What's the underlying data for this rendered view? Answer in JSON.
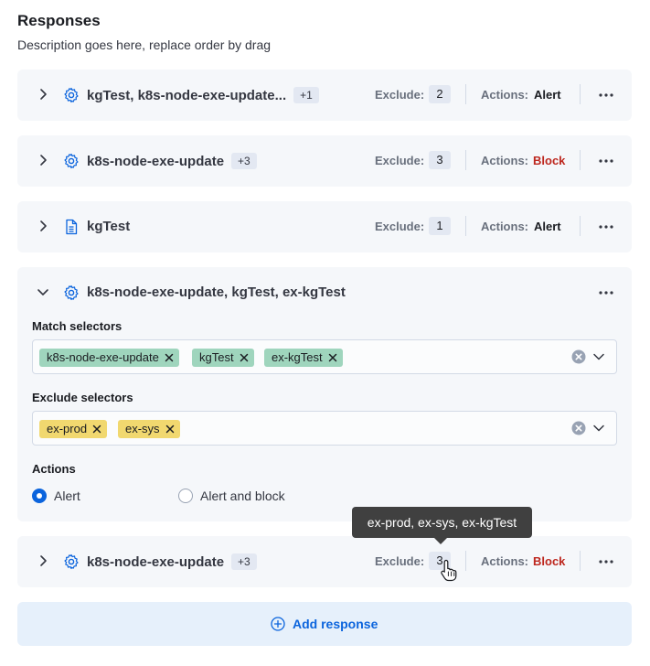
{
  "header": {
    "title": "Responses",
    "description": "Description goes here, replace order by drag"
  },
  "labels": {
    "exclude": "Exclude:",
    "actions": "Actions:"
  },
  "responses": [
    {
      "title": "kgTest, k8s-node-exe-update...",
      "extra": "+1",
      "icon": "gear-icon",
      "exclude_count": "2",
      "action": "Alert"
    },
    {
      "title": "k8s-node-exe-update",
      "extra": "+3",
      "icon": "gear-icon",
      "exclude_count": "3",
      "action": "Block"
    },
    {
      "title": "kgTest",
      "extra": "",
      "icon": "document-icon",
      "exclude_count": "1",
      "action": "Alert"
    },
    {
      "title": "k8s-node-exe-update, kgTest, ex-kgTest",
      "icon": "gear-icon",
      "match_label": "Match selectors",
      "match": [
        "k8s-node-exe-update",
        "kgTest",
        "ex-kgTest"
      ],
      "exclude_label": "Exclude selectors",
      "exclude": [
        "ex-prod",
        "ex-sys"
      ],
      "actions_label": "Actions",
      "options": [
        "Alert",
        "Alert and block"
      ],
      "selected": "Alert"
    },
    {
      "title": "k8s-node-exe-update",
      "extra": "+3",
      "icon": "gear-icon",
      "exclude_count": "3",
      "action": "Block"
    }
  ],
  "tooltip": "ex-prod, ex-sys, ex-kgTest",
  "add_button": {
    "label": "Add response",
    "icon": "plus-circle-icon"
  },
  "colors": {
    "accent": "#0b64dd",
    "block": "#bd271e",
    "match_pill": "#9fd5bd",
    "exclude_pill": "#f1d86f",
    "panel_bg": "#f5f7fa"
  }
}
